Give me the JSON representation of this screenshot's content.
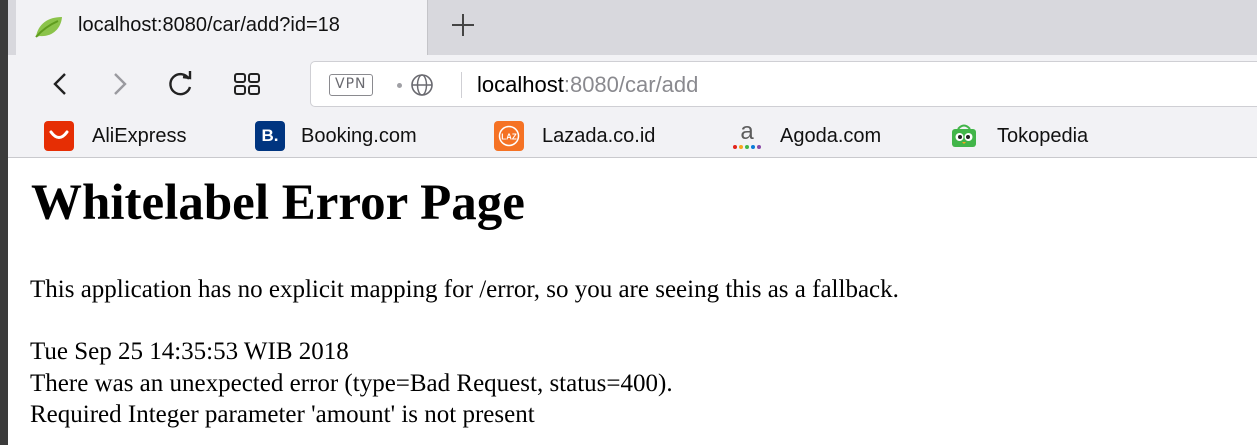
{
  "tab": {
    "title": "localhost:8080/car/add?id=18",
    "favicon": "spring-leaf-icon",
    "new_tab_icon": "plus-icon"
  },
  "toolbar": {
    "back_icon": "back-chevron-icon",
    "forward_icon": "forward-chevron-icon",
    "reload_icon": "reload-icon",
    "speed_dial_icon": "grid-icon",
    "vpn_label": "VPN",
    "security_icon": "globe-icon",
    "url_host": "localhost",
    "url_rest": ":8080/car/add"
  },
  "bookmarks": [
    {
      "label": "AliExpress",
      "icon": "aliexpress-icon",
      "color": "#e62e04"
    },
    {
      "label": "Booking.com",
      "icon": "booking-icon",
      "glyph": "B.",
      "color": "#003580"
    },
    {
      "label": "Lazada.co.id",
      "icon": "lazada-icon",
      "glyph": "LAZ",
      "color": "#f57224"
    },
    {
      "label": "Agoda.com",
      "icon": "agoda-icon",
      "glyph": "a",
      "color": "#5c5c5c"
    },
    {
      "label": "Tokopedia",
      "icon": "tokopedia-icon",
      "color": "#42b549"
    }
  ],
  "page": {
    "title": "Whitelabel Error Page",
    "description": "This application has no explicit mapping for /error, so you are seeing this as a fallback.",
    "timestamp": "Tue Sep 25 14:35:53 WIB 2018",
    "error_line": "There was an unexpected error (type=Bad Request, status=400).",
    "message": "Required Integer parameter 'amount' is not present"
  }
}
